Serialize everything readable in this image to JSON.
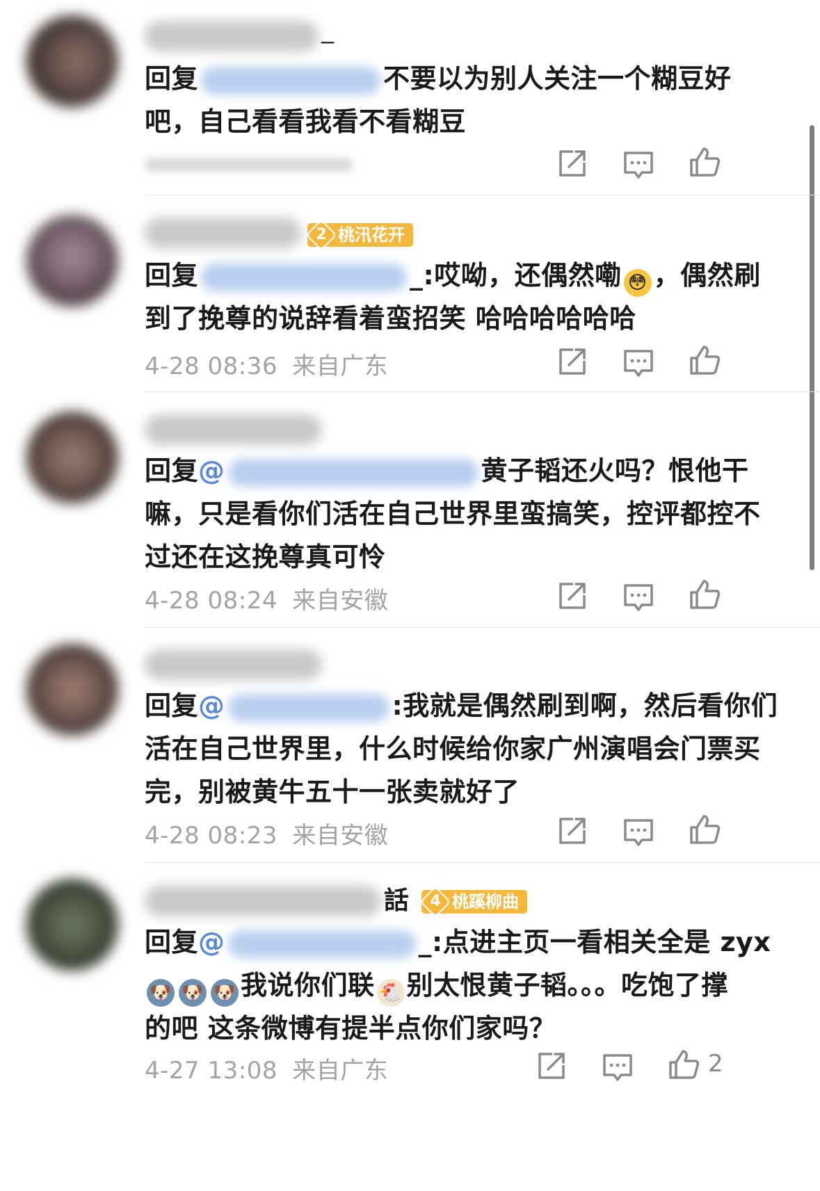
{
  "comments": [
    {
      "reply_prefix": "回复",
      "line1": "不要以为别人关注一个糊豆好",
      "line2": "吧，自己看看我看不看糊豆",
      "username_tail": "_",
      "time": "",
      "location": "",
      "likes": ""
    },
    {
      "reply_prefix": "回复",
      "username_tail": "",
      "badge": {
        "level": "2",
        "name": "桃汛花开",
        "color": "#f5b73c"
      },
      "line1_after_mention": "_:哎呦，还偶然嘞",
      "line1_end": "，偶然刷",
      "line2": "到了挽尊的说辞看着蛮招笑 哈哈哈哈哈哈",
      "emoji": "shy-smile-emoji",
      "time": "4-28 08:36",
      "location": "来自广东",
      "likes": ""
    },
    {
      "reply_prefix": "回复",
      "mention_at": "@",
      "line1_after_mention": "黄子韬还火吗？恨他干",
      "line2": "嘛，只是看你们活在自己世界里蛮搞笑，控评都控不",
      "line3": "过还在这挽尊真可怜",
      "time": "4-28 08:24",
      "location": "来自安徽",
      "likes": ""
    },
    {
      "reply_prefix": "回复",
      "mention_at": "@",
      "line1_after_mention": ":我就是偶然刷到啊，然后看你们",
      "line2": "活在自己世界里，什么时候给你家广州演唱会门票买",
      "line3": "完，别被黄牛五十一张卖就好了",
      "time": "4-28 08:23",
      "location": "来自安徽",
      "likes": ""
    },
    {
      "reply_prefix": "回复",
      "mention_at": "@",
      "username_tail": "話",
      "badge": {
        "level": "4",
        "name": "桃蹊柳曲",
        "color": "#f5b73c"
      },
      "line1_after_mention": "_:点进主页一看相关全是 zyx",
      "line2_text_a": "我说你们联",
      "line2_text_b": "别太恨黄子韬。。。吃饱了撑",
      "line3": "的吧 这条微博有提半点你们家吗？",
      "emojis": [
        "husky-emoji",
        "husky-emoji",
        "husky-emoji",
        "chicken-emoji"
      ],
      "time": "4-27 13:08",
      "location": "来自广东",
      "likes": "2"
    }
  ],
  "colors": {
    "meta_gray": "#a3a3a3",
    "icon_gray": "#8a8a8a",
    "badge_orange": "#f5b73c"
  },
  "icons": [
    "share-icon",
    "comment-icon",
    "like-icon"
  ]
}
